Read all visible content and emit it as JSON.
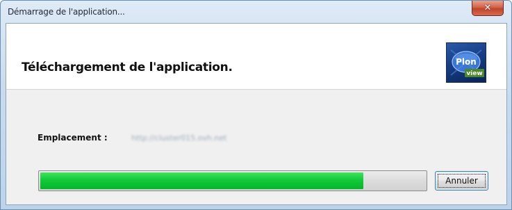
{
  "window": {
    "title": "Démarrage de l'application...",
    "close_glyph": "✕"
  },
  "header": {
    "title": "Téléchargement de l'application.",
    "logo": {
      "icon": "ploneview-logo-icon",
      "text_top": "Plon",
      "text_bottom": "view"
    }
  },
  "body": {
    "location_label": "Emplacement :",
    "location_value": "http://cluster015.ovh.net"
  },
  "progress": {
    "fraction": 0.84,
    "color": "#13c93a"
  },
  "buttons": {
    "cancel_label": "Annuler"
  }
}
